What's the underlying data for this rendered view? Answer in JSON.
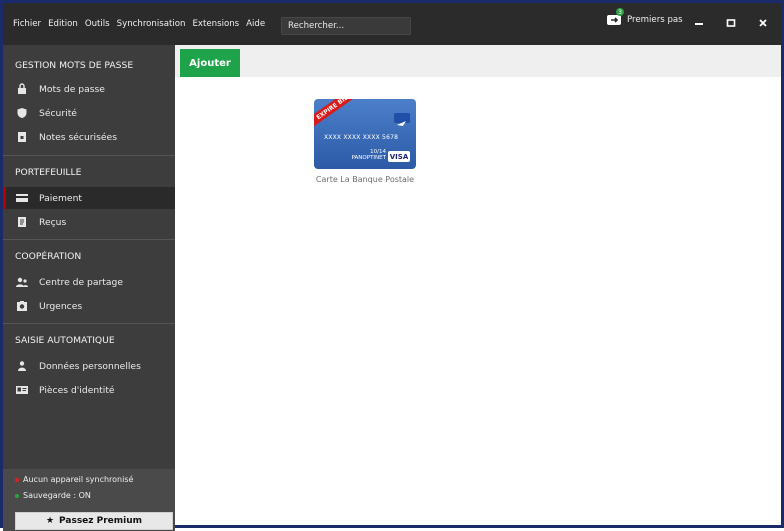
{
  "menu": {
    "items": [
      "Fichier",
      "Edition",
      "Outils",
      "Synchronisation",
      "Extensions",
      "Aide"
    ],
    "search_placeholder": "Rechercher...",
    "premiers_pas": "Premiers pas",
    "badge": "3"
  },
  "sidebar": {
    "sections": [
      {
        "title": "GESTION MOTS DE PASSE",
        "items": [
          "Mots de passe",
          "Sécurité",
          "Notes sécurisées"
        ]
      },
      {
        "title": "PORTEFEUILLE",
        "items": [
          "Paiement",
          "Reçus"
        ]
      },
      {
        "title": "COOPÉRATION",
        "items": [
          "Centre de partage",
          "Urgences"
        ]
      },
      {
        "title": "SAISIE AUTOMATIQUE",
        "items": [
          "Données personnelles",
          "Pièces d'identité"
        ]
      }
    ],
    "active_item": "Paiement",
    "status": {
      "sync": "Aucun appareil synchronisé",
      "backup": "Sauvegarde : ON"
    },
    "premium_button": "Passez Premium"
  },
  "main": {
    "add_button": "Ajouter",
    "card": {
      "ribbon": "EXPIRE BIENTÔT",
      "number": "XXXX XXXX XXXX 5678",
      "exp": "10/14",
      "holder": "PANOPTINET",
      "brand": "VISA",
      "caption": "Carte La Banque Postale"
    }
  },
  "colors": {
    "accent_green": "#1fa34a",
    "active_red": "#b80000",
    "sidebar_bg": "#3d3d3d",
    "topbar_bg": "#2b2b2b"
  }
}
